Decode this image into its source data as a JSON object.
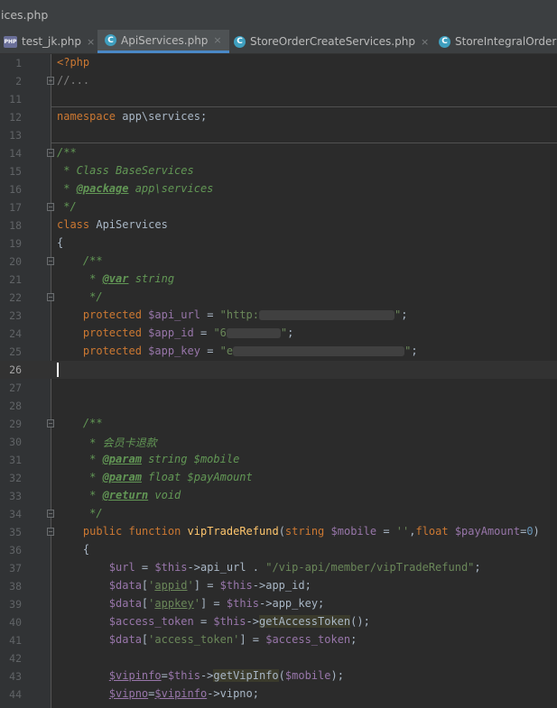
{
  "window": {
    "title": "ices.php"
  },
  "tabs": [
    {
      "label": "test_jk.php",
      "icon": "php-file-icon",
      "close": "×"
    },
    {
      "label": "ApiServices.php",
      "icon": "class-icon",
      "close": "×",
      "active": true
    },
    {
      "label": "StoreOrderCreateServices.php",
      "icon": "class-icon",
      "close": "×"
    },
    {
      "label": "StoreIntegralOrderS",
      "icon": "class-icon"
    }
  ],
  "editor": {
    "current_line": "26",
    "lines": [
      {
        "n": "1",
        "t": "<?php"
      },
      {
        "n": "2",
        "t": "//..."
      },
      {
        "n": "11",
        "t": ""
      },
      {
        "n": "12",
        "t": "namespace app\\services;"
      },
      {
        "n": "13",
        "t": ""
      },
      {
        "n": "14",
        "t": "/**"
      },
      {
        "n": "15",
        "t": " * Class BaseServices"
      },
      {
        "n": "16",
        "t": " * @package app\\services"
      },
      {
        "n": "17",
        "t": " */"
      },
      {
        "n": "18",
        "t": "class ApiServices"
      },
      {
        "n": "19",
        "t": "{"
      },
      {
        "n": "20",
        "t": "    /**"
      },
      {
        "n": "21",
        "t": "     * @var string"
      },
      {
        "n": "22",
        "t": "     */"
      },
      {
        "n": "23",
        "t": "    protected $api_url = \"http:"
      },
      {
        "n": "24",
        "t": "    protected $app_id = \"6"
      },
      {
        "n": "25",
        "t": "    protected $app_key = \"e"
      },
      {
        "n": "26",
        "t": ""
      },
      {
        "n": "27",
        "t": ""
      },
      {
        "n": "28",
        "t": ""
      },
      {
        "n": "29",
        "t": "    /**"
      },
      {
        "n": "30",
        "t": "     * 会员卡退款"
      },
      {
        "n": "31",
        "t": "     * @param string $mobile"
      },
      {
        "n": "32",
        "t": "     * @param float $payAmount"
      },
      {
        "n": "33",
        "t": "     * @return void"
      },
      {
        "n": "34",
        "t": "     */"
      },
      {
        "n": "35",
        "t": "    public function vipTradeRefund(string $mobile = '',float $payAmount=0)"
      },
      {
        "n": "36",
        "t": "    {"
      },
      {
        "n": "37",
        "t": "        $url = $this->api_url . \"/vip-api/member/vipTradeRefund\";"
      },
      {
        "n": "38",
        "t": "        $data['appid'] = $this->app_id;"
      },
      {
        "n": "39",
        "t": "        $data['appkey'] = $this->app_key;"
      },
      {
        "n": "40",
        "t": "        $access_token = $this->getAccessToken();"
      },
      {
        "n": "41",
        "t": "        $data['access_token'] = $access_token;"
      },
      {
        "n": "42",
        "t": ""
      },
      {
        "n": "43",
        "t": "        $vipinfo=$this->getVipInfo($mobile);"
      },
      {
        "n": "44",
        "t": "        $vipno=$vipinfo->vipno;"
      }
    ]
  },
  "colors": {
    "bg": "#2b2b2b",
    "keyword": "#cc7832",
    "variable": "#9876aa",
    "string": "#6a8759",
    "comment": "#629755",
    "function": "#ffc66d",
    "number": "#6897bb"
  }
}
